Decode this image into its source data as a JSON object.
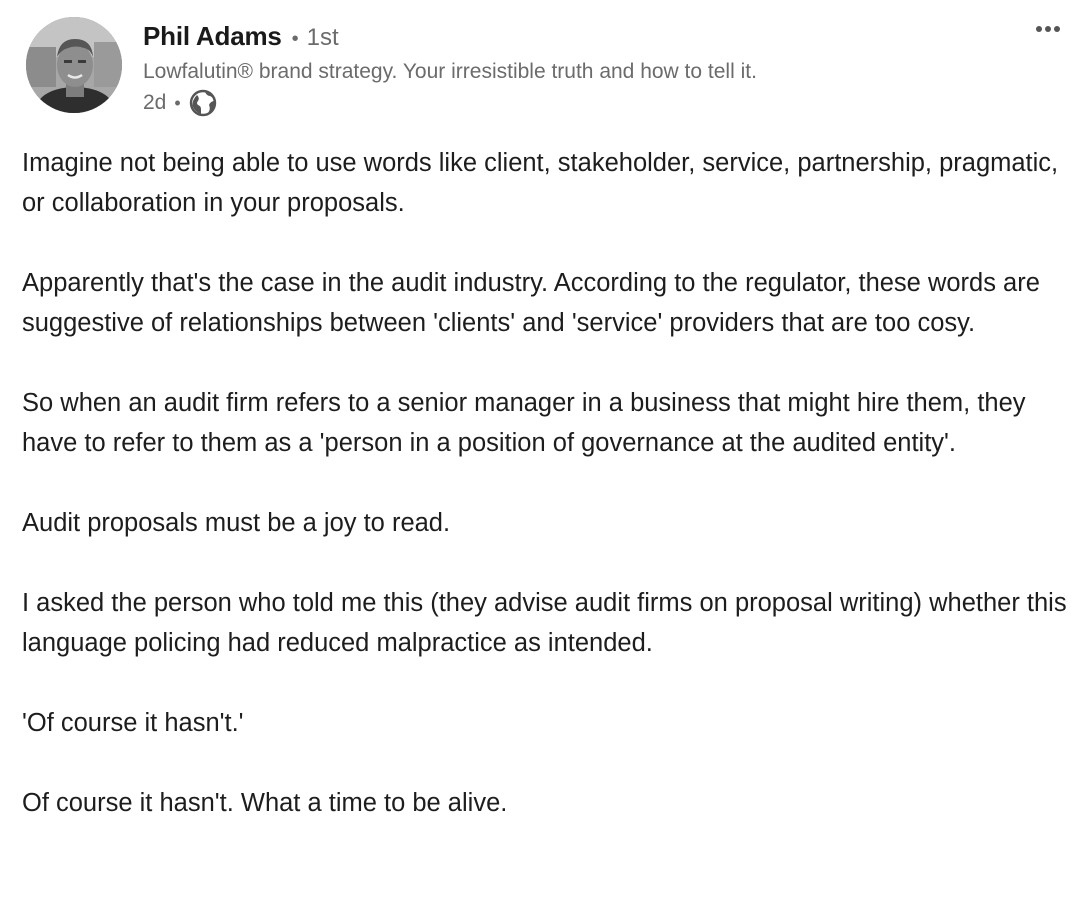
{
  "author": {
    "name": "Phil Adams",
    "connection_degree": "1st",
    "headline": "Lowfalutin® brand strategy. Your irresistible truth and how to tell it.",
    "posted_time": "2d",
    "visibility_icon": "globe-icon",
    "avatar_icon": "profile-photo"
  },
  "actions": {
    "more_icon": "more-horizontal-icon"
  },
  "post": {
    "paragraphs": [
      "Imagine not being able to use words like client, stakeholder, service, partnership, pragmatic, or collaboration in your proposals.",
      "Apparently that's the case in the audit industry. According to the regulator, these words are suggestive of relationships between 'clients' and 'service' providers that are too cosy.",
      "So when an audit firm refers to a senior manager in a business that might hire them, they have to refer to them as a 'person in a position of governance at the audited entity'.",
      "Audit proposals must be a joy to read.",
      "I asked the person who told me this (they advise audit firms on proposal writing) whether this language policing had reduced malpractice as intended.",
      "'Of course it hasn't.'",
      "Of course it hasn't. What a time to be alive."
    ]
  },
  "colors": {
    "text_primary": "#1d1d1d",
    "text_secondary": "#6b6b6b",
    "background": "#ffffff"
  }
}
